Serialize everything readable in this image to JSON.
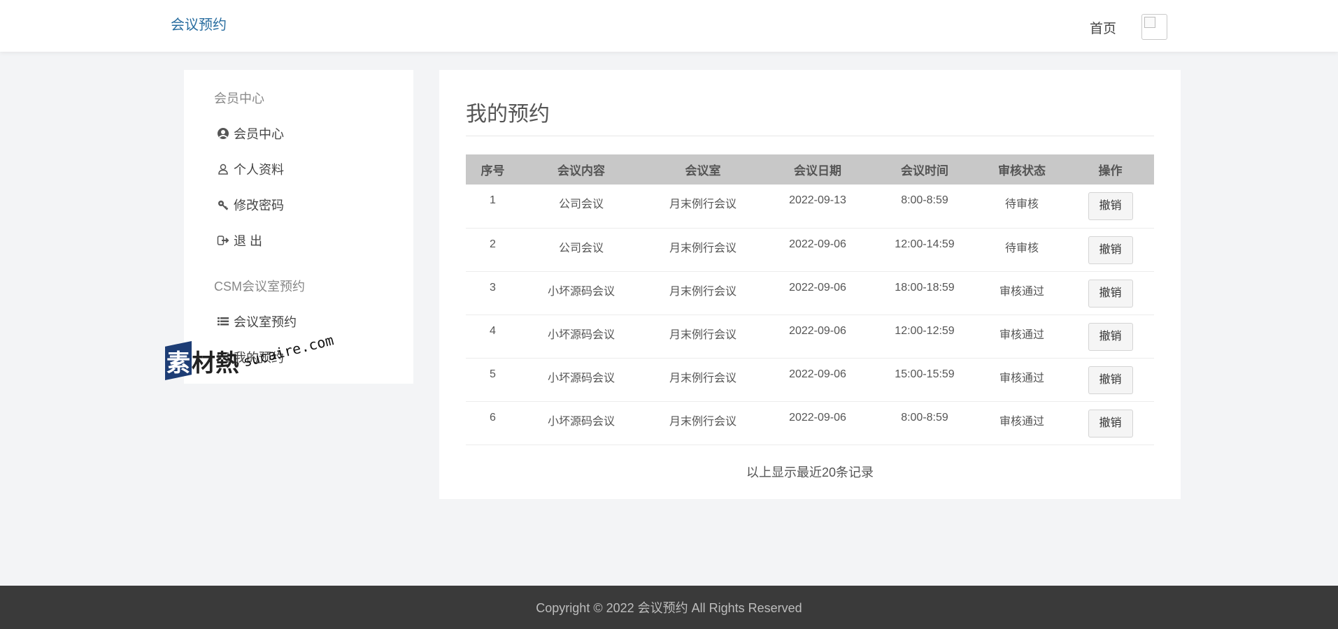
{
  "header": {
    "brand": "会议预约",
    "nav_home": "首页"
  },
  "sidebar": {
    "group1": "会员中心",
    "items1": [
      {
        "label": "会员中心",
        "icon": "user-circle-icon"
      },
      {
        "label": "个人资料",
        "icon": "user-icon"
      },
      {
        "label": "修改密码",
        "icon": "key-icon"
      },
      {
        "label": "退 出",
        "icon": "sign-out-icon"
      }
    ],
    "group2": "CSM会议室预约",
    "items2": [
      {
        "label": "会议室预约",
        "icon": "list-icon"
      },
      {
        "label": "我的预约",
        "icon": "calendar-icon"
      }
    ]
  },
  "main": {
    "title": "我的预约",
    "columns": [
      "序号",
      "会议内容",
      "会议室",
      "会议日期",
      "会议时间",
      "审核状态",
      "操作"
    ],
    "rows": [
      {
        "no": "1",
        "content": "公司会议",
        "room": "月末例行会议",
        "date": "2022-09-13",
        "time": "8:00-8:59",
        "status": "待审核",
        "action": "撤销"
      },
      {
        "no": "2",
        "content": "公司会议",
        "room": "月末例行会议",
        "date": "2022-09-06",
        "time": "12:00-14:59",
        "status": "待审核",
        "action": "撤销"
      },
      {
        "no": "3",
        "content": "小坏源码会议",
        "room": "月末例行会议",
        "date": "2022-09-06",
        "time": "18:00-18:59",
        "status": "审核通过",
        "action": "撤销"
      },
      {
        "no": "4",
        "content": "小坏源码会议",
        "room": "月末例行会议",
        "date": "2022-09-06",
        "time": "12:00-12:59",
        "status": "审核通过",
        "action": "撤销"
      },
      {
        "no": "5",
        "content": "小坏源码会议",
        "room": "月末例行会议",
        "date": "2022-09-06",
        "time": "15:00-15:59",
        "status": "审核通过",
        "action": "撤销"
      },
      {
        "no": "6",
        "content": "小坏源码会议",
        "room": "月末例行会议",
        "date": "2022-09-06",
        "time": "8:00-8:59",
        "status": "审核通过",
        "action": "撤销"
      }
    ],
    "note": "以上显示最近20条记录"
  },
  "footer": {
    "copyright": "Copyright © 2022 会议预约 All Rights Reserved"
  },
  "watermark": {
    "cn_first": "素",
    "cn_rest": "材熱",
    "en": "sucaire.com"
  },
  "colors": {
    "brand": "#2a6ea0",
    "footer_bg": "#3a3a3a",
    "table_header_bg": "#c8c8c8",
    "page_bg": "#f3f4f6"
  }
}
